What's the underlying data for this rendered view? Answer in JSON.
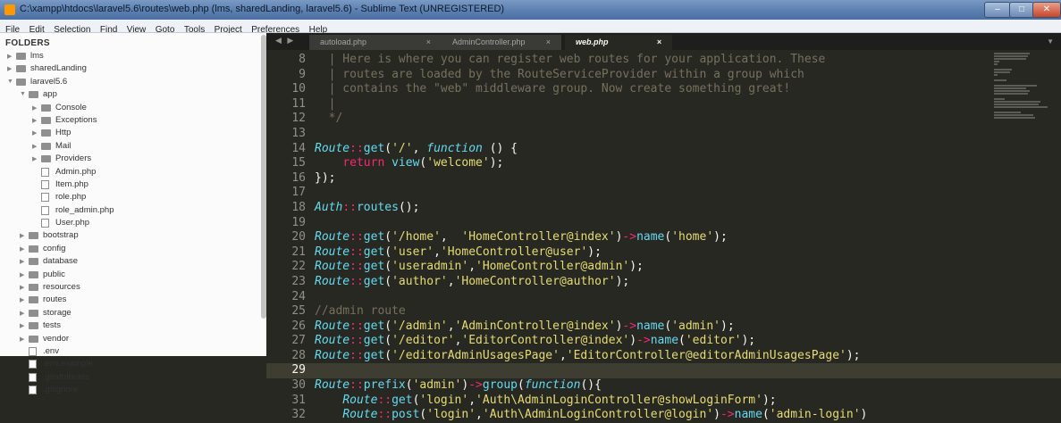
{
  "window": {
    "title": "C:\\xampp\\htdocs\\laravel5.6\\routes\\web.php (lms, sharedLanding, laravel5.6) - Sublime Text (UNREGISTERED)"
  },
  "menu": [
    "File",
    "Edit",
    "Selection",
    "Find",
    "View",
    "Goto",
    "Tools",
    "Project",
    "Preferences",
    "Help"
  ],
  "sidebar": {
    "heading": "FOLDERS",
    "items": [
      {
        "label": "lms",
        "type": "folder",
        "depth": 0,
        "expanded": false
      },
      {
        "label": "sharedLanding",
        "type": "folder",
        "depth": 0,
        "expanded": false
      },
      {
        "label": "laravel5.6",
        "type": "folder",
        "depth": 0,
        "expanded": true
      },
      {
        "label": "app",
        "type": "folder",
        "depth": 1,
        "expanded": true
      },
      {
        "label": "Console",
        "type": "folder",
        "depth": 2,
        "expanded": false
      },
      {
        "label": "Exceptions",
        "type": "folder",
        "depth": 2,
        "expanded": false
      },
      {
        "label": "Http",
        "type": "folder",
        "depth": 2,
        "expanded": false
      },
      {
        "label": "Mail",
        "type": "folder",
        "depth": 2,
        "expanded": false
      },
      {
        "label": "Providers",
        "type": "folder",
        "depth": 2,
        "expanded": false
      },
      {
        "label": "Admin.php",
        "type": "file",
        "depth": 2
      },
      {
        "label": "Item.php",
        "type": "file",
        "depth": 2
      },
      {
        "label": "role.php",
        "type": "file",
        "depth": 2
      },
      {
        "label": "role_admin.php",
        "type": "file",
        "depth": 2
      },
      {
        "label": "User.php",
        "type": "file",
        "depth": 2
      },
      {
        "label": "bootstrap",
        "type": "folder",
        "depth": 1,
        "expanded": false
      },
      {
        "label": "config",
        "type": "folder",
        "depth": 1,
        "expanded": false
      },
      {
        "label": "database",
        "type": "folder",
        "depth": 1,
        "expanded": false
      },
      {
        "label": "public",
        "type": "folder",
        "depth": 1,
        "expanded": false
      },
      {
        "label": "resources",
        "type": "folder",
        "depth": 1,
        "expanded": false
      },
      {
        "label": "routes",
        "type": "folder",
        "depth": 1,
        "expanded": false
      },
      {
        "label": "storage",
        "type": "folder",
        "depth": 1,
        "expanded": false
      },
      {
        "label": "tests",
        "type": "folder",
        "depth": 1,
        "expanded": false
      },
      {
        "label": "vendor",
        "type": "folder",
        "depth": 1,
        "expanded": false
      },
      {
        "label": ".env",
        "type": "file",
        "depth": 1
      },
      {
        "label": ".env.example",
        "type": "file",
        "depth": 1
      },
      {
        "label": ".gitattributes",
        "type": "file",
        "depth": 1
      },
      {
        "label": ".gitignore",
        "type": "file",
        "depth": 1
      }
    ]
  },
  "tabs": [
    {
      "label": "autoload.php",
      "active": false
    },
    {
      "label": "AdminController.php",
      "active": false
    },
    {
      "label": "web.php",
      "active": true
    }
  ],
  "tab_close_glyph": "×",
  "editor": {
    "highlighted_line": "29",
    "lines": [
      {
        "n": "8",
        "tokens": [
          {
            "t": "  | Here is where you can register web routes for your application. These",
            "c": "cm"
          }
        ]
      },
      {
        "n": "9",
        "tokens": [
          {
            "t": "  | routes are loaded by the RouteServiceProvider within a group which",
            "c": "cm"
          }
        ]
      },
      {
        "n": "10",
        "tokens": [
          {
            "t": "  | contains the \"web\" middleware group. Now create something great!",
            "c": "cm"
          }
        ]
      },
      {
        "n": "11",
        "tokens": [
          {
            "t": "  |",
            "c": "cm"
          }
        ]
      },
      {
        "n": "12",
        "tokens": [
          {
            "t": "  */",
            "c": "cm"
          }
        ]
      },
      {
        "n": "13",
        "tokens": []
      },
      {
        "n": "14",
        "tokens": [
          {
            "t": "Route",
            "c": "cls"
          },
          {
            "t": "::",
            "c": "kw"
          },
          {
            "t": "get",
            "c": "fn"
          },
          {
            "t": "(",
            "c": ""
          },
          {
            "t": "'/'",
            "c": "str"
          },
          {
            "t": ", ",
            "c": ""
          },
          {
            "t": "function",
            "c": "it"
          },
          {
            "t": " () {",
            "c": ""
          }
        ]
      },
      {
        "n": "15",
        "tokens": [
          {
            "t": "    ",
            "c": ""
          },
          {
            "t": "return",
            "c": "kw"
          },
          {
            "t": " ",
            "c": ""
          },
          {
            "t": "view",
            "c": "fn"
          },
          {
            "t": "(",
            "c": ""
          },
          {
            "t": "'welcome'",
            "c": "str"
          },
          {
            "t": ");",
            "c": ""
          }
        ]
      },
      {
        "n": "16",
        "tokens": [
          {
            "t": "});",
            "c": ""
          }
        ]
      },
      {
        "n": "17",
        "tokens": []
      },
      {
        "n": "18",
        "tokens": [
          {
            "t": "Auth",
            "c": "cls"
          },
          {
            "t": "::",
            "c": "kw"
          },
          {
            "t": "routes",
            "c": "fn"
          },
          {
            "t": "();",
            "c": ""
          }
        ]
      },
      {
        "n": "19",
        "tokens": []
      },
      {
        "n": "20",
        "tokens": [
          {
            "t": "Route",
            "c": "cls"
          },
          {
            "t": "::",
            "c": "kw"
          },
          {
            "t": "get",
            "c": "fn"
          },
          {
            "t": "(",
            "c": ""
          },
          {
            "t": "'/home'",
            "c": "str"
          },
          {
            "t": ",  ",
            "c": ""
          },
          {
            "t": "'HomeController@index'",
            "c": "str"
          },
          {
            "t": ")",
            "c": ""
          },
          {
            "t": "->",
            "c": "kw"
          },
          {
            "t": "name",
            "c": "fn"
          },
          {
            "t": "(",
            "c": ""
          },
          {
            "t": "'home'",
            "c": "str"
          },
          {
            "t": ");",
            "c": ""
          }
        ]
      },
      {
        "n": "21",
        "tokens": [
          {
            "t": "Route",
            "c": "cls"
          },
          {
            "t": "::",
            "c": "kw"
          },
          {
            "t": "get",
            "c": "fn"
          },
          {
            "t": "(",
            "c": ""
          },
          {
            "t": "'user'",
            "c": "str"
          },
          {
            "t": ",",
            "c": ""
          },
          {
            "t": "'HomeController@user'",
            "c": "str"
          },
          {
            "t": ");",
            "c": ""
          }
        ]
      },
      {
        "n": "22",
        "tokens": [
          {
            "t": "Route",
            "c": "cls"
          },
          {
            "t": "::",
            "c": "kw"
          },
          {
            "t": "get",
            "c": "fn"
          },
          {
            "t": "(",
            "c": ""
          },
          {
            "t": "'useradmin'",
            "c": "str"
          },
          {
            "t": ",",
            "c": ""
          },
          {
            "t": "'HomeController@admin'",
            "c": "str"
          },
          {
            "t": ");",
            "c": ""
          }
        ]
      },
      {
        "n": "23",
        "tokens": [
          {
            "t": "Route",
            "c": "cls"
          },
          {
            "t": "::",
            "c": "kw"
          },
          {
            "t": "get",
            "c": "fn"
          },
          {
            "t": "(",
            "c": ""
          },
          {
            "t": "'author'",
            "c": "str"
          },
          {
            "t": ",",
            "c": ""
          },
          {
            "t": "'HomeController@author'",
            "c": "str"
          },
          {
            "t": ");",
            "c": ""
          }
        ]
      },
      {
        "n": "24",
        "tokens": []
      },
      {
        "n": "25",
        "tokens": [
          {
            "t": "//admin route",
            "c": "cm"
          }
        ]
      },
      {
        "n": "26",
        "tokens": [
          {
            "t": "Route",
            "c": "cls"
          },
          {
            "t": "::",
            "c": "kw"
          },
          {
            "t": "get",
            "c": "fn"
          },
          {
            "t": "(",
            "c": ""
          },
          {
            "t": "'/admin'",
            "c": "str"
          },
          {
            "t": ",",
            "c": ""
          },
          {
            "t": "'AdminController@index'",
            "c": "str"
          },
          {
            "t": ")",
            "c": ""
          },
          {
            "t": "->",
            "c": "kw"
          },
          {
            "t": "name",
            "c": "fn"
          },
          {
            "t": "(",
            "c": ""
          },
          {
            "t": "'admin'",
            "c": "str"
          },
          {
            "t": ");",
            "c": ""
          }
        ]
      },
      {
        "n": "27",
        "tokens": [
          {
            "t": "Route",
            "c": "cls"
          },
          {
            "t": "::",
            "c": "kw"
          },
          {
            "t": "get",
            "c": "fn"
          },
          {
            "t": "(",
            "c": ""
          },
          {
            "t": "'/editor'",
            "c": "str"
          },
          {
            "t": ",",
            "c": ""
          },
          {
            "t": "'EditorController@index'",
            "c": "str"
          },
          {
            "t": ")",
            "c": ""
          },
          {
            "t": "->",
            "c": "kw"
          },
          {
            "t": "name",
            "c": "fn"
          },
          {
            "t": "(",
            "c": ""
          },
          {
            "t": "'editor'",
            "c": "str"
          },
          {
            "t": ");",
            "c": ""
          }
        ]
      },
      {
        "n": "28",
        "tokens": [
          {
            "t": "Route",
            "c": "cls"
          },
          {
            "t": "::",
            "c": "kw"
          },
          {
            "t": "get",
            "c": "fn"
          },
          {
            "t": "(",
            "c": ""
          },
          {
            "t": "'/editorAdminUsagesPage'",
            "c": "str"
          },
          {
            "t": ",",
            "c": ""
          },
          {
            "t": "'EditorController@editorAdminUsagesPage'",
            "c": "str"
          },
          {
            "t": ");",
            "c": ""
          }
        ]
      },
      {
        "n": "29",
        "tokens": []
      },
      {
        "n": "30",
        "tokens": [
          {
            "t": "Route",
            "c": "cls"
          },
          {
            "t": "::",
            "c": "kw"
          },
          {
            "t": "prefix",
            "c": "fn"
          },
          {
            "t": "(",
            "c": ""
          },
          {
            "t": "'admin'",
            "c": "str"
          },
          {
            "t": ")",
            "c": ""
          },
          {
            "t": "->",
            "c": "kw"
          },
          {
            "t": "group",
            "c": "fn"
          },
          {
            "t": "(",
            "c": ""
          },
          {
            "t": "function",
            "c": "it"
          },
          {
            "t": "(){",
            "c": ""
          }
        ]
      },
      {
        "n": "31",
        "tokens": [
          {
            "t": "    ",
            "c": ""
          },
          {
            "t": "Route",
            "c": "cls"
          },
          {
            "t": "::",
            "c": "kw"
          },
          {
            "t": "get",
            "c": "fn"
          },
          {
            "t": "(",
            "c": ""
          },
          {
            "t": "'login'",
            "c": "str"
          },
          {
            "t": ",",
            "c": ""
          },
          {
            "t": "'Auth\\AdminLoginController@showLoginForm'",
            "c": "str"
          },
          {
            "t": ");",
            "c": ""
          }
        ]
      },
      {
        "n": "32",
        "tokens": [
          {
            "t": "    ",
            "c": ""
          },
          {
            "t": "Route",
            "c": "cls"
          },
          {
            "t": "::",
            "c": "kw"
          },
          {
            "t": "post",
            "c": "fn"
          },
          {
            "t": "(",
            "c": ""
          },
          {
            "t": "'login'",
            "c": "str"
          },
          {
            "t": ",",
            "c": ""
          },
          {
            "t": "'Auth\\AdminLoginController@login'",
            "c": "str"
          },
          {
            "t": ")",
            "c": ""
          },
          {
            "t": "->",
            "c": "kw"
          },
          {
            "t": "name",
            "c": "fn"
          },
          {
            "t": "(",
            "c": ""
          },
          {
            "t": "'admin-login'",
            "c": "str"
          },
          {
            "t": ")",
            "c": ""
          }
        ]
      }
    ]
  },
  "icons": {
    "app": "sublime-text-icon",
    "minimize": "minimize-icon",
    "maximize": "maximize-icon",
    "close": "close-icon",
    "folder": "folder-icon",
    "file": "file-icon",
    "tab_nav": "tab-navigation-arrows-icon",
    "tab_dropdown": "chevron-down-icon"
  },
  "colors": {
    "editor_bg": "#272822",
    "keyword": "#f92672",
    "string": "#e6db74",
    "function": "#66d9ef",
    "comment": "#75715e"
  }
}
